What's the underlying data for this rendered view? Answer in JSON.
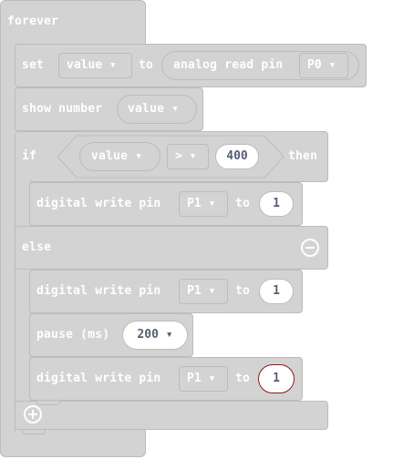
{
  "forever": {
    "label": "forever"
  },
  "set_block": {
    "label": "set",
    "variable": "value ▾",
    "to_label": "to",
    "reporter_label": "analog read pin",
    "pin": "P0 ▾"
  },
  "show_number": {
    "label": "show number",
    "variable": "value ▾"
  },
  "if_block": {
    "if_label": "if",
    "variable": "value ▾",
    "operator": "> ▾",
    "compare_value": "400",
    "then_label": "then",
    "else_label": "else"
  },
  "digital_write_1": {
    "label": "digital write pin",
    "pin": "P1 ▾",
    "to_label": "to",
    "value": "1"
  },
  "digital_write_2": {
    "label": "digital write pin",
    "pin": "P1 ▾",
    "to_label": "to",
    "value": "1"
  },
  "pause": {
    "label": "pause (ms)",
    "value": "200 ▾"
  },
  "digital_write_3": {
    "label": "digital write pin",
    "pin": "P1 ▾",
    "to_label": "to",
    "value": "1"
  },
  "colors": {
    "block": "#d3d3d3",
    "block_border": "#bcbcbc",
    "text": "#ffffff",
    "number_text": "#575E75",
    "selected_outline": "#8b1a1a"
  },
  "icons": {
    "add": "plus-circle-icon",
    "remove": "minus-circle-icon"
  }
}
